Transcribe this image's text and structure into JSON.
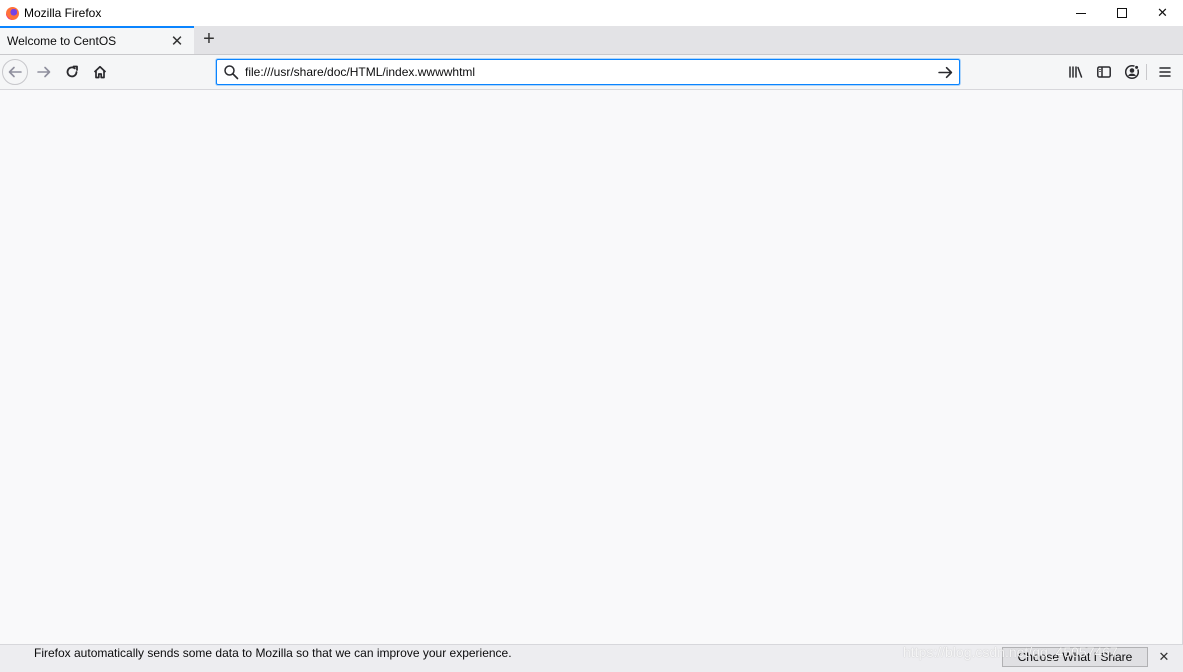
{
  "window": {
    "title": "Mozilla Firefox",
    "controls": {
      "minimize": "",
      "maximize": "",
      "close": "✕"
    }
  },
  "tabs": [
    {
      "label": "Welcome to CentOS",
      "active": true
    }
  ],
  "tabstrip": {
    "close_glyph": "✕",
    "new_tab_glyph": "+"
  },
  "navbar": {
    "back_icon": "arrow-left-icon",
    "forward_icon": "arrow-right-icon",
    "reload_icon": "reload-icon",
    "home_icon": "home-icon",
    "url_value": "file:///usr/share/doc/HTML/index.wwwwhtml",
    "go_icon": "arrow-right-icon"
  },
  "toolbar": {
    "icons": [
      "library-icon",
      "sidebar-icon",
      "account-icon",
      "hamburger-menu-icon"
    ]
  },
  "notification": {
    "text": "Firefox automatically sends some data to Mozilla so that we can improve your experience.",
    "button_label": "Choose What I Share",
    "close_glyph": "✕"
  },
  "watermark": "https://blog.csdn.net/qq_45057467",
  "colors": {
    "accent": "#0a84ff",
    "chrome": "#f5f6f7",
    "tabstrip": "#e3e3e6",
    "content": "#f9f9fa"
  }
}
